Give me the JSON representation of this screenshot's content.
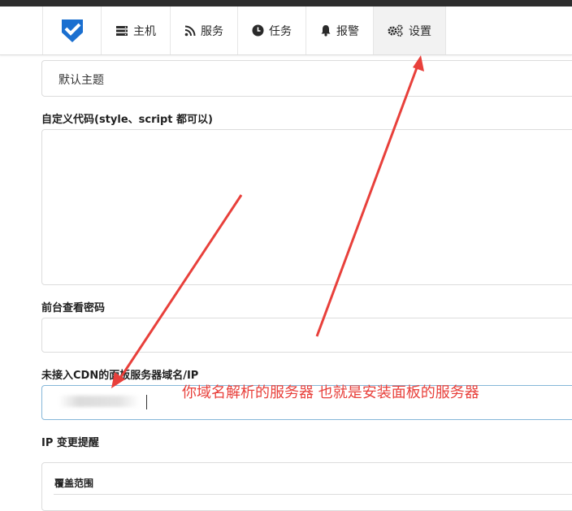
{
  "nav": {
    "items": [
      {
        "label": "主机",
        "icon": "server-icon"
      },
      {
        "label": "服务",
        "icon": "rss-icon"
      },
      {
        "label": "任务",
        "icon": "clock-icon"
      },
      {
        "label": "报警",
        "icon": "bell-icon"
      },
      {
        "label": "设置",
        "icon": "gears-icon",
        "active": true
      }
    ],
    "logo_color": "#1a6fd0"
  },
  "form": {
    "theme_value": "默认主题",
    "custom_code_label": "自定义代码(style、script 都可以)",
    "frontend_password_label": "前台查看密码",
    "panel_ip_label": "未接入CDN的面板服务器域名/IP",
    "ip_change_label": "IP 变更提醒",
    "coverage_label": "覆盖范围"
  },
  "annotation": {
    "text": "你域名解析的服务器 也就是安装面板的服务器",
    "color": "#e8403b"
  }
}
